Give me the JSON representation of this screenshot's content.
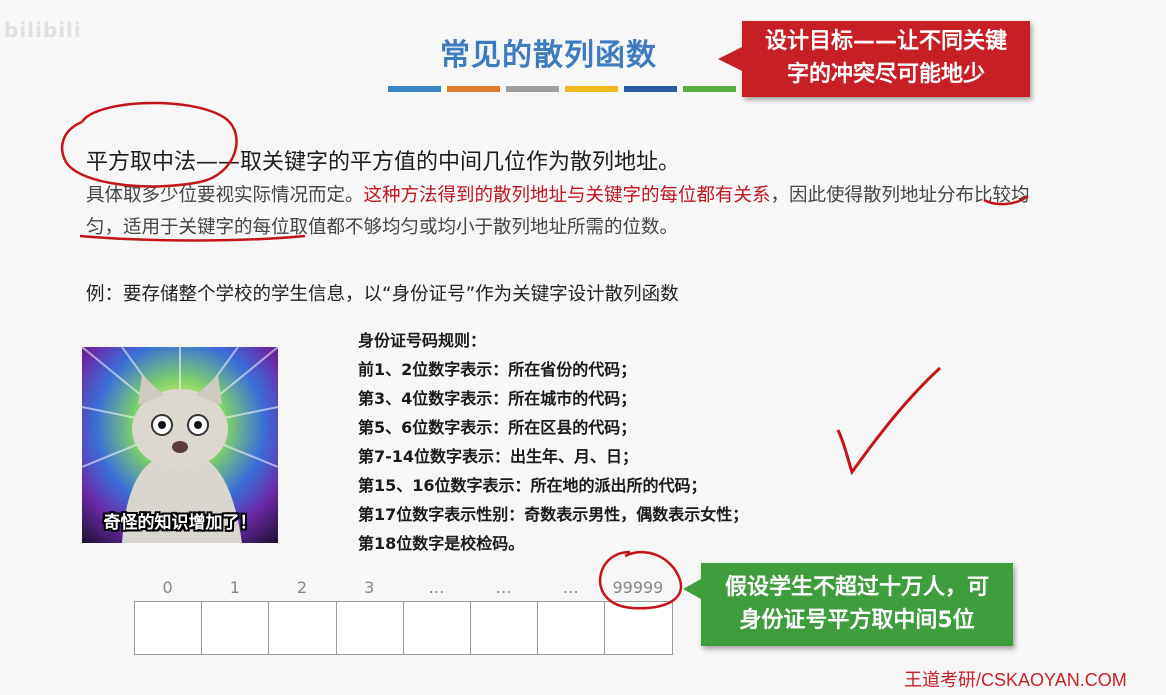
{
  "watermark": "bilibili",
  "slide": {
    "title": "常见的散列函数",
    "design_goal": {
      "line1": "设计目标——让不同关键",
      "line2": "字的冲突尽可能地少",
      "color": "#c81f25"
    },
    "divider_colors": [
      "#3a86c9",
      "#e07d2c",
      "#9e9e9e",
      "#f2b91e",
      "#2c5aa0",
      "#5aac44"
    ],
    "method": {
      "name": "平方取中法",
      "definition": "——取关键字的平方值的中间几位作为散列地址。"
    },
    "description": {
      "part1": "具体取多少位要视实际情况而定。",
      "highlight": "这种方法得到的散列地址与关键字的每位都有关系",
      "part2": "，因此使得散列地址分布比较均匀，适用于关键字的每位取值都不够均匀或均小于散列地址所需的位数。"
    },
    "example": "例：要存储整个学校的学生信息，以“身份证号”作为关键字设计散列函数",
    "meme_caption": "奇怪的知识增加了！",
    "id_rules": [
      "身份证号码规则：",
      "前1、2位数字表示：所在省份的代码；",
      "第3、4位数字表示：所在城市的代码；",
      "第5、6位数字表示：所在区县的代码；",
      "第7-14位数字表示：出生年、月、日；",
      "第15、16位数字表示：所在地的派出所的代码；",
      "第17位数字表示性别：奇数表示男性，偶数表示女性；",
      "第18位数字是校检码。"
    ],
    "table_indices": [
      "0",
      "1",
      "2",
      "3",
      "…",
      "…",
      "…",
      "99999"
    ],
    "assumption": {
      "line1": "假设学生不超过十万人，可",
      "line2": "身份证号平方取中间5位",
      "color": "#3f9e3c"
    },
    "footer": "王道考研/CSKAOYAN.COM"
  }
}
